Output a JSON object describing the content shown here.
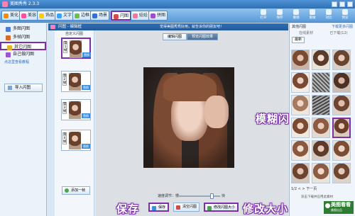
{
  "app": {
    "title": "美图秀秀 2.3.3"
  },
  "toolbar": {
    "tabs": [
      {
        "label": "美化",
        "color": "#ff8a00"
      },
      {
        "label": "美容",
        "color": "#ff4f9b"
      },
      {
        "label": "饰品",
        "color": "#ffcc00"
      },
      {
        "label": "文字",
        "color": "#39a2ff"
      },
      {
        "label": "边框",
        "color": "#6bc04b"
      },
      {
        "label": "场景",
        "color": "#2f6fd6"
      },
      {
        "label": "闪图",
        "color": "#d04b4b",
        "selected": true
      },
      {
        "label": "娃娃",
        "color": "#ff6fa0"
      },
      {
        "label": "拼图",
        "color": "#a14bd0"
      }
    ],
    "right_tools": [
      "打开",
      "保存",
      "撤销",
      "重做",
      "对比",
      "预览"
    ]
  },
  "left_tree": {
    "items": [
      {
        "label": "多图闪图",
        "color": "#4d7bd6"
      },
      {
        "label": "多帧闪图",
        "color": "#d96a2a"
      },
      {
        "label": "其它闪图",
        "color": "#e3b326",
        "selected": true
      },
      {
        "label": "自己做闪图",
        "color": "#9a56d3"
      }
    ],
    "link": "点这里查看教程",
    "import_button": "导入闪图"
  },
  "subtitle": {
    "text": "闪图 - 编辑框"
  },
  "frames": {
    "header": "自定义闪图",
    "items": [
      {
        "num": "第1帧",
        "replace": "替换"
      },
      {
        "num": "第2帧",
        "replace": "替换"
      },
      {
        "num": "第3帧",
        "replace": "替换"
      },
      {
        "num": "第4帧",
        "replace": "替换"
      }
    ],
    "add_button": "添加一帧"
  },
  "banner": "觉得美图秀秀好用，就告诉你的朋友吧！",
  "view_tabs": [
    {
      "label": "编辑闪图"
    },
    {
      "label": "预览闪图效果",
      "selected": true
    }
  ],
  "speed": {
    "label": "速度调节：慢",
    "fast_label": "快",
    "value": 0.8
  },
  "bottom_buttons": {
    "save": "保存",
    "clear": "清空闪图",
    "resize": "修改闪图大小"
  },
  "annotations": {
    "save": "保存",
    "resize": "修改大小",
    "effect": "模糊闪图效果"
  },
  "right_panel": {
    "header": "其他闪图",
    "more": "下载更多闪图",
    "sub_left": "在线素材",
    "sub_right": "已下载(12)",
    "select": "最新",
    "pager": "1/2 < > 下一页",
    "tip": "双击下载并应用此素材",
    "brand": "美图看看",
    "brand_sub": "美图出品"
  }
}
